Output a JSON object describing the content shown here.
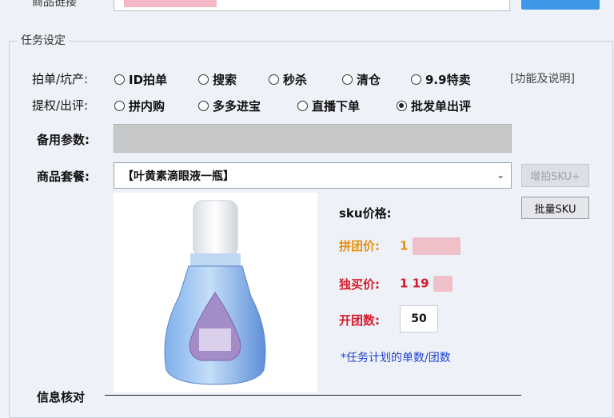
{
  "top": {
    "label": "商品链接"
  },
  "task_settings": {
    "title": "任务设定",
    "row1": {
      "label": "拍单/坑产:",
      "options": [
        "ID拍单",
        "搜索",
        "秒杀",
        "清仓",
        "9.9特卖"
      ],
      "help": "[功能及说明]"
    },
    "row2": {
      "label": "提权/出评:",
      "options": [
        "拼内购",
        "多多进宝",
        "直播下单",
        "批发单出评"
      ],
      "selected": "批发单出评"
    },
    "param_label": "备用参数:",
    "package_label": "商品套餐:",
    "package_value": "【叶黄素滴眼液一瓶】",
    "add_sku_button": "增拍SKU+",
    "batch_sku_button": "批量SKU",
    "sku_price_label": "sku价格:",
    "group_price_label": "拼团价:",
    "group_price_value": "1",
    "solo_price_label": "独买价:",
    "solo_price_value": "1 19",
    "group_count_label": "开团数:",
    "group_count_value": "50",
    "hint": "*任务计划的单数/团数",
    "colors": {
      "group_price": "#e8900c",
      "solo_price": "#d61a2a",
      "count_label": "#d61a2a",
      "hint": "#1d3fd0"
    }
  },
  "footer": {
    "info_label": "信息核对"
  }
}
